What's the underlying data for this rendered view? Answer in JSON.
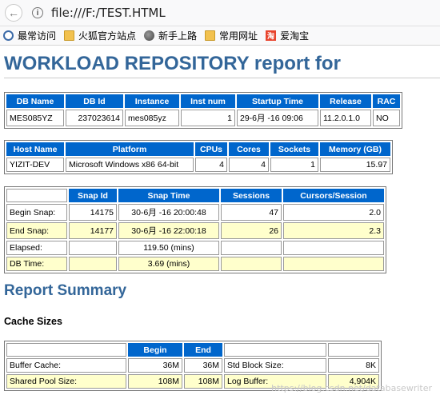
{
  "browser": {
    "url": "file:///F:/TEST.HTML",
    "bookmarks": [
      {
        "label": "最常访问",
        "icon": "gear-icon"
      },
      {
        "label": "火狐官方站点",
        "icon": "folder-icon"
      },
      {
        "label": "新手上路",
        "icon": "globe-icon"
      },
      {
        "label": "常用网址",
        "icon": "folder-icon"
      },
      {
        "label": "爱淘宝",
        "icon": "taobao-icon"
      }
    ],
    "taobao_glyph": "淘"
  },
  "report": {
    "title": "WORKLOAD REPOSITORY report for",
    "db_table": {
      "headers": [
        "DB Name",
        "DB Id",
        "Instance",
        "Inst num",
        "Startup Time",
        "Release",
        "RAC"
      ],
      "row": [
        "MES085YZ",
        "237023614",
        "mes085yz",
        "1",
        "29-6月 -16 09:06",
        "11.2.0.1.0",
        "NO"
      ]
    },
    "host_table": {
      "headers": [
        "Host Name",
        "Platform",
        "CPUs",
        "Cores",
        "Sockets",
        "Memory (GB)"
      ],
      "row": [
        "YIZIT-DEV",
        "Microsoft Windows x86 64-bit",
        "4",
        "4",
        "1",
        "15.97"
      ]
    },
    "snap_table": {
      "headers": [
        "",
        "Snap Id",
        "Snap Time",
        "Sessions",
        "Cursors/Session"
      ],
      "rows": [
        [
          "Begin Snap:",
          "14175",
          "30-6月 -16 20:00:48",
          "47",
          "2.0"
        ],
        [
          "End Snap:",
          "14177",
          "30-6月 -16 22:00:18",
          "26",
          "2.3"
        ],
        [
          "Elapsed:",
          "",
          "119.50 (mins)",
          "",
          ""
        ],
        [
          "DB Time:",
          "",
          "3.69 (mins)",
          "",
          ""
        ]
      ]
    },
    "summary_title": "Report Summary",
    "cache_title": "Cache Sizes",
    "cache_table": {
      "headers": [
        "",
        "Begin",
        "End",
        "",
        ""
      ],
      "rows": [
        [
          "Buffer Cache:",
          "36M",
          "36M",
          "Std Block Size:",
          "8K"
        ],
        [
          "Shared Pool Size:",
          "108M",
          "108M",
          "Log Buffer:",
          "4,904K"
        ]
      ]
    }
  },
  "watermark": "https://blog.csdn.net/databasewriter"
}
